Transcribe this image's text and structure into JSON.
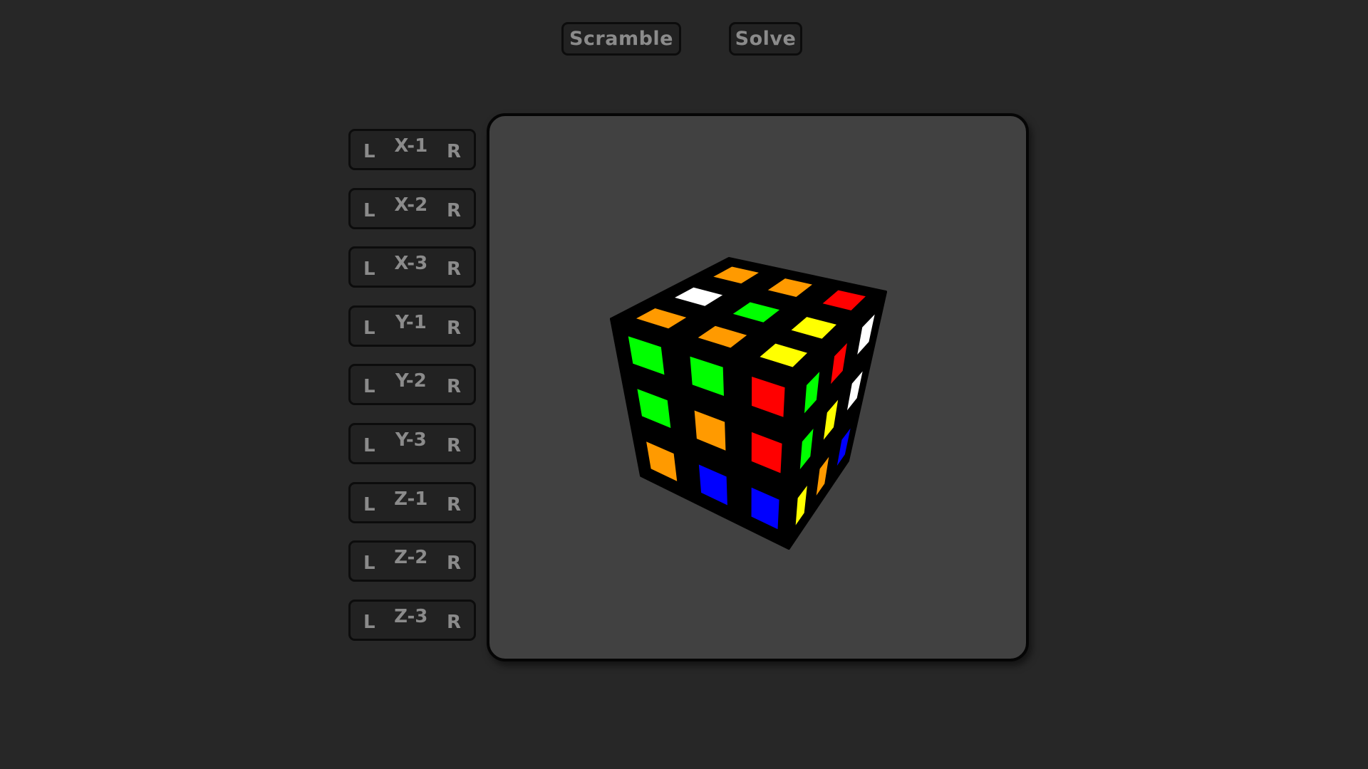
{
  "toolbar": {
    "scramble_label": "Scramble",
    "solve_label": "Solve"
  },
  "controls": [
    {
      "label": "X-1",
      "left": "L",
      "right": "R"
    },
    {
      "label": "X-2",
      "left": "L",
      "right": "R"
    },
    {
      "label": "X-3",
      "left": "L",
      "right": "R"
    },
    {
      "label": "Y-1",
      "left": "L",
      "right": "R"
    },
    {
      "label": "Y-2",
      "left": "L",
      "right": "R"
    },
    {
      "label": "Y-3",
      "left": "L",
      "right": "R"
    },
    {
      "label": "Z-1",
      "left": "L",
      "right": "R"
    },
    {
      "label": "Z-2",
      "left": "L",
      "right": "R"
    },
    {
      "label": "Z-3",
      "left": "L",
      "right": "R"
    }
  ],
  "colors": {
    "orange": "#ff9a00",
    "white": "#ffffff",
    "green": "#00ff00",
    "red": "#ff0000",
    "yellow": "#ffff00",
    "blue": "#0000ff"
  },
  "cube": {
    "top": [
      [
        "orange",
        "white",
        "orange"
      ],
      [
        "orange",
        "green",
        "orange"
      ],
      [
        "red",
        "yellow",
        "yellow"
      ]
    ],
    "front": [
      [
        "green",
        "green",
        "red"
      ],
      [
        "green",
        "orange",
        "red"
      ],
      [
        "orange",
        "blue",
        "blue"
      ]
    ],
    "right": [
      [
        "green",
        "red",
        "white"
      ],
      [
        "green",
        "yellow",
        "white"
      ],
      [
        "yellow",
        "orange",
        "blue"
      ]
    ]
  }
}
